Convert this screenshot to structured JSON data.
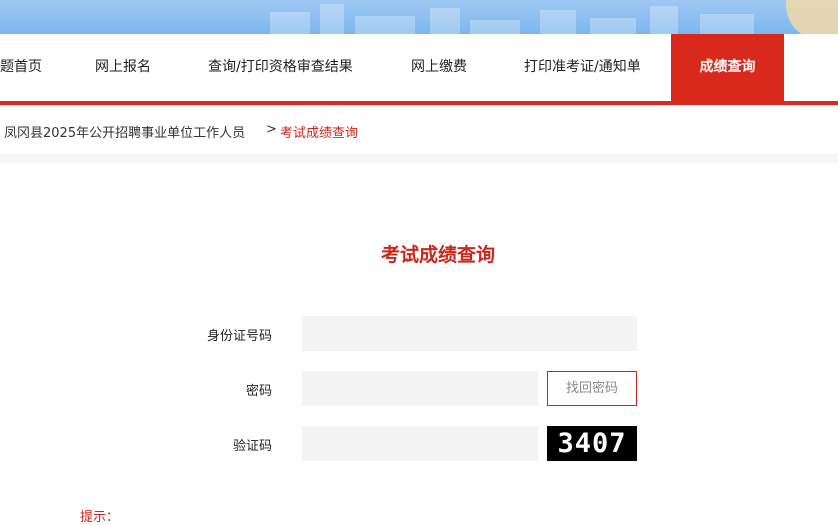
{
  "nav": {
    "items": [
      {
        "label": "题首页"
      },
      {
        "label": "网上报名"
      },
      {
        "label": "查询/打印资格审查结果"
      },
      {
        "label": "网上缴费"
      },
      {
        "label": "打印准考证/通知单"
      },
      {
        "label": "成绩查询",
        "active": true
      }
    ]
  },
  "breadcrumb": {
    "parent": "凤冈县2025年公开招聘事业单位工作人员",
    "separator": ">",
    "current": "考试成绩查询"
  },
  "form": {
    "title": "考试成绩查询",
    "id_label": "身份证号码",
    "id_value": "",
    "password_label": "密码",
    "password_value": "",
    "recover_button": "找回密码",
    "captcha_label": "验证码",
    "captcha_value": "",
    "captcha_image_text": "3407"
  },
  "tip": "提示："
}
